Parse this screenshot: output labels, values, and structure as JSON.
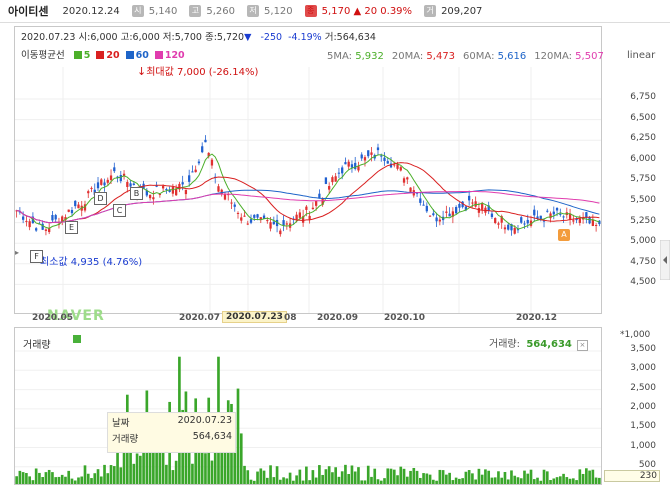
{
  "header": {
    "stock_name": "아이티센",
    "date": "2020.12.24",
    "open_badge": "시",
    "open": "5,140",
    "high_badge": "고",
    "high": "5,260",
    "low_badge": "저",
    "low": "5,120",
    "close_badge": "종",
    "close": "5,170",
    "change": "▲ 20",
    "change_pct": "0.39%",
    "volume_badge": "거",
    "volume": "209,207"
  },
  "info": {
    "date": "2020.07.23",
    "open": "시:6,000",
    "high": "고:6,000",
    "low": "저:5,700",
    "close": "종:5,720",
    "arrow": "▼",
    "change": "-250",
    "change_pct": "-4.19%",
    "volume": "거:564,634"
  },
  "ma_legend": {
    "title": "이동평균선",
    "items": [
      {
        "label": "5",
        "color": "#4caf2a"
      },
      {
        "label": "20",
        "color": "#d92020"
      },
      {
        "label": "60",
        "color": "#1e64c8"
      },
      {
        "label": "120",
        "color": "#e03cae"
      }
    ]
  },
  "ma_values": [
    {
      "label": "5MA:",
      "value": "5,932",
      "color": "#4caf2a"
    },
    {
      "label": "20MA:",
      "value": "5,473",
      "color": "#d92020"
    },
    {
      "label": "60MA:",
      "value": "5,616",
      "color": "#1e64c8"
    },
    {
      "label": "120MA:",
      "value": "5,507",
      "color": "#e03cae"
    }
  ],
  "scale": "linear",
  "y_ticks": [
    "6,750",
    "6,500",
    "6,250",
    "6,000",
    "5,750",
    "5,500",
    "5,250",
    "5,000",
    "4,750",
    "4,500"
  ],
  "x_labels": [
    "2020.05",
    "2020.07",
    "2020.07.23",
    "08",
    "2020.09",
    "2020.10",
    "2020.12"
  ],
  "annotations": {
    "high": "최대값 7,000 (-26.14%)",
    "low": "최소값 4,935 (4.76%)",
    "markers": [
      "B",
      "C",
      "D",
      "E",
      "F",
      "A"
    ]
  },
  "watermark": "NAVER",
  "volume_panel": {
    "label": "거래량",
    "value_label": "거래량:",
    "value": "564,634",
    "close": "×",
    "unit": "*1,000",
    "y_ticks": [
      "3,500",
      "3,000",
      "2,500",
      "2,000",
      "1,500",
      "1,000",
      "500"
    ],
    "current": "230"
  },
  "tooltip": {
    "date_label": "날짜",
    "date": "2020.07.23",
    "vol_label": "거래량",
    "vol": "564,634"
  }
}
